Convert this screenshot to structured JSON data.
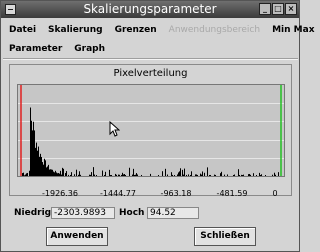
{
  "window": {
    "title": "Skalierungsparameter"
  },
  "menubar": {
    "row1": [
      {
        "label": "Datei",
        "enabled": true
      },
      {
        "label": "Skalierung",
        "enabled": true
      },
      {
        "label": "Grenzen",
        "enabled": true
      },
      {
        "label": "Anwendungsbereich",
        "enabled": false
      },
      {
        "label": "Min Max",
        "enabled": true
      }
    ],
    "row2": [
      {
        "label": "Parameter",
        "enabled": true
      },
      {
        "label": "Graph",
        "enabled": true
      }
    ]
  },
  "graph": {
    "title": "Pixelverteilung",
    "x_tick_labels": [
      "-1926.36",
      "-1444.77",
      "-963.18",
      "-481.59",
      "0"
    ]
  },
  "fields": {
    "niedrig_label": "Niedrig",
    "niedrig_value": "-2303.9893",
    "hoch_label": "Hoch",
    "hoch_value": "94.52"
  },
  "buttons": {
    "apply_label": "Anwenden",
    "close_label": "Schließen"
  },
  "colors": {
    "low_marker": "#e02020",
    "high_marker": "#20c020",
    "histogram": "#000000"
  },
  "icons": {
    "window_menu": "window-menu-icon",
    "minimize": "minimize-icon",
    "maximize": "maximize-icon",
    "close": "close-icon",
    "cursor": "arrow-cursor-icon"
  }
}
